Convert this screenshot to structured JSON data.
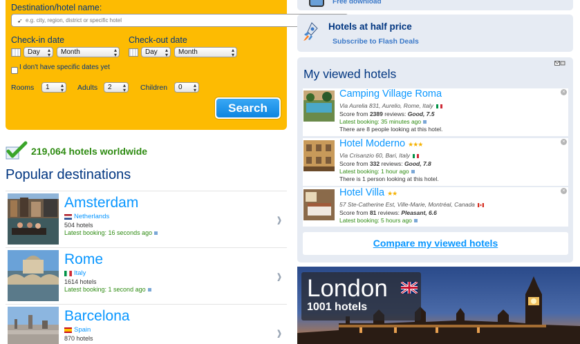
{
  "search": {
    "destination_label": "Destination/hotel name:",
    "destination_placeholder": "e.g. city, region, district or specific hotel",
    "checkin_label": "Check-in date",
    "checkout_label": "Check-out date",
    "checkin_day": "Day",
    "checkin_month": "Month",
    "checkout_day": "Day",
    "checkout_month": "Month",
    "no_dates_label": "I don't have specific dates yet",
    "rooms_label": "Rooms",
    "rooms_value": "1",
    "adults_label": "Adults",
    "adults_value": "2",
    "children_label": "Children",
    "children_value": "0",
    "search_button": "Search"
  },
  "worldwide": "219,064 hotels worldwide",
  "popular_title": "Popular destinations",
  "destinations": [
    {
      "name": "Amsterdam",
      "country": "Netherlands",
      "hotels": "504 hotels",
      "latest": "Latest booking: 16 seconds ago"
    },
    {
      "name": "Rome",
      "country": "Italy",
      "hotels": "1614 hotels",
      "latest": "Latest booking: 1 second ago"
    },
    {
      "name": "Barcelona",
      "country": "Spain",
      "hotels": "870 hotels",
      "latest": ""
    }
  ],
  "right": {
    "free_download": "Free download",
    "half_price_title": "Hotels at half price",
    "half_price_link": "Subscribe to Flash Deals",
    "viewed_title": "My viewed hotels",
    "viewed": [
      {
        "name": "Camping Village Roma",
        "stars": "",
        "address": "Via Aurelia 831, Aurelio, Rome, Italy",
        "score_pre": "Score from ",
        "reviews": "2389",
        "score_mid": " reviews: ",
        "score": "Good, 7.5",
        "latest": "Latest booking: 35 minutes ago",
        "looking": "There are 8 people looking at this hotel."
      },
      {
        "name": "Hotel Moderno",
        "stars": "★★★",
        "address": "Via Crisanzio 60, Bari, Italy",
        "score_pre": "Score from ",
        "reviews": "332",
        "score_mid": " reviews: ",
        "score": "Good, 7.8",
        "latest": "Latest booking: 1 hour ago",
        "looking": "There is 1 person looking at this hotel."
      },
      {
        "name": "Hotel Villa",
        "stars": "★★",
        "address": "57 Ste-Catherine Est, Ville-Marie, Montréal, Canada",
        "score_pre": "Score from ",
        "reviews": "81",
        "score_mid": " reviews: ",
        "score": "Pleasant, 6.6",
        "latest": "Latest booking: 5 hours ago",
        "looking": ""
      }
    ],
    "compare_link": "Compare my viewed hotels",
    "london_city": "London",
    "london_hotels": "1001 hotels"
  },
  "colors": {
    "search_bg": "#fdbb02",
    "link_blue": "#0896ff",
    "heading_navy": "#003580",
    "success_green": "#2e8b12",
    "panel_bg": "#e6ebf3"
  }
}
